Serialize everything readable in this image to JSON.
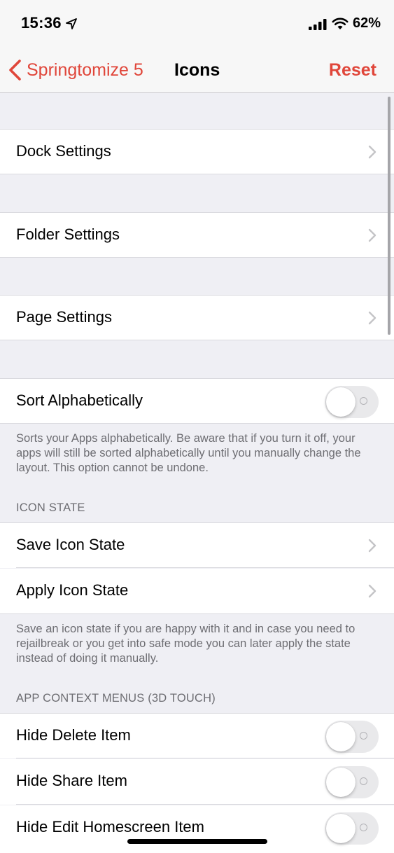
{
  "status_bar": {
    "time": "15:36",
    "battery": "62%",
    "icons": [
      "location-arrow-icon",
      "cellular-signal-icon",
      "wifi-icon"
    ]
  },
  "nav": {
    "back_label": "Springtomize 5",
    "title": "Icons",
    "reset_label": "Reset",
    "accent_color": "#e0463a"
  },
  "rows": {
    "dock": "Dock Settings",
    "folder": "Folder Settings",
    "page": "Page Settings",
    "sort": "Sort Alphabetically"
  },
  "sort_footer": "Sorts your Apps alphabetically. Be aware that if you turn it off, your apps will still be sorted alphabetically until you manually change the layout. This option cannot be undone.",
  "icon_state": {
    "header": "ICON STATE",
    "save": "Save Icon State",
    "apply": "Apply Icon State",
    "footer": "Save an icon state if you are happy with it and in case you need to rejailbreak or you get into safe mode you can later apply the state instead of doing it manually."
  },
  "context_menus": {
    "header": "APP CONTEXT MENUS (3D TOUCH)",
    "hide_delete": "Hide Delete Item",
    "hide_share": "Hide Share Item",
    "hide_edit": "Hide Edit Homescreen Item"
  },
  "toggles": {
    "sort_alphabetically": false,
    "hide_delete": false,
    "hide_share": false,
    "hide_edit": false
  }
}
